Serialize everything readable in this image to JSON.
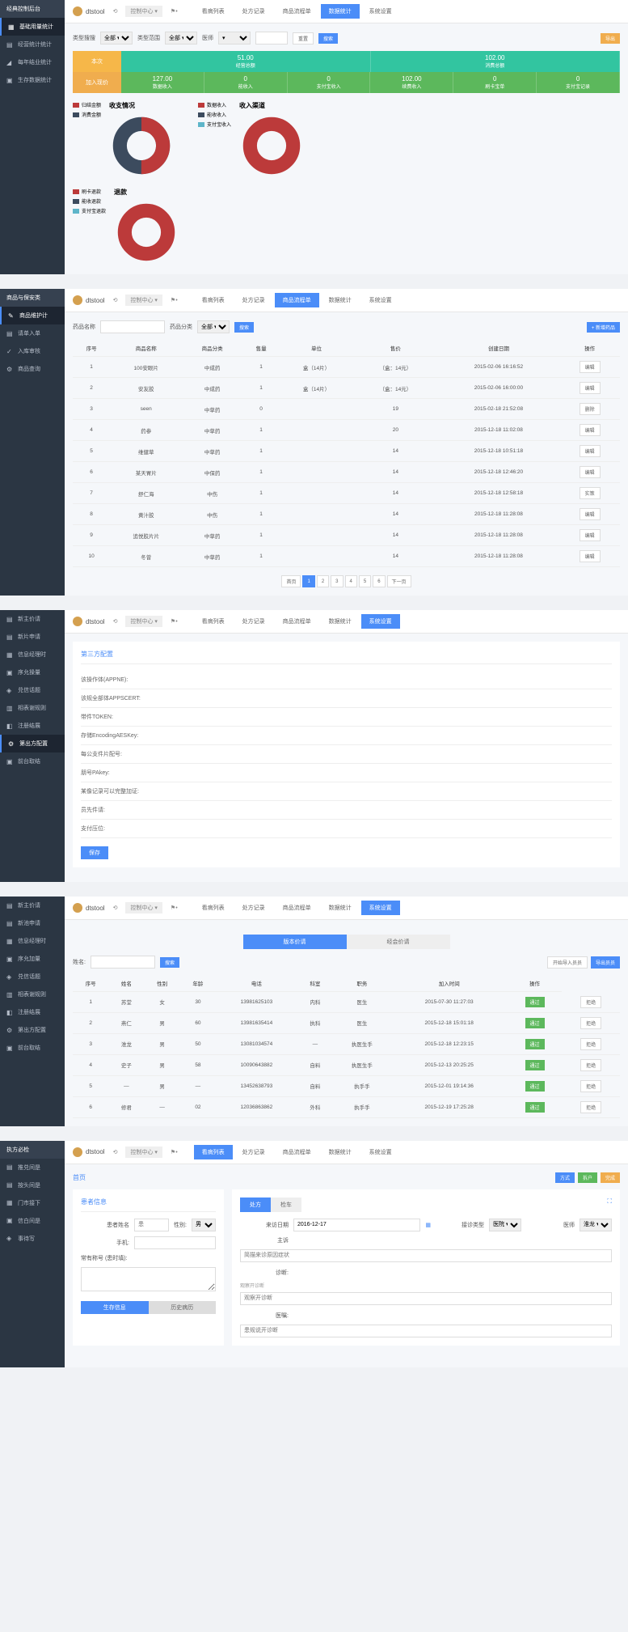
{
  "brand": "dtstool",
  "top_dd": "控制中心 ▾",
  "tabs": [
    "看病列表",
    "处方记录",
    "商品流程单",
    "数据统计",
    "系统设置"
  ],
  "s1": {
    "sidebar_hdr": "经典控制后台",
    "sidebar": [
      {
        "icon": "▦",
        "label": "基础用量统计"
      },
      {
        "icon": "▤",
        "label": "经营统计统计"
      },
      {
        "icon": "◢",
        "label": "每年结业统计"
      },
      {
        "icon": "▣",
        "label": "生存数据统计"
      }
    ],
    "filters": {
      "l1": "类型搜搜",
      "l2": "类型范围",
      "l3": "医师",
      "opt1": "全部 ▾",
      "opt2": "全部 ▾",
      "opt3": "▾",
      "reset": "重置",
      "search": "搜索",
      "export": "导出"
    },
    "left_cards": {
      "top": "本次",
      "bot": "加入现价"
    },
    "sumtop": [
      {
        "v": "51.00",
        "l": "经营总额"
      },
      {
        "v": "102.00",
        "l": "消费总额"
      }
    ],
    "sumbot": [
      {
        "v": "127.00",
        "l": "数据收入"
      },
      {
        "v": "0",
        "l": "能收入"
      },
      {
        "v": "0",
        "l": "支付宝收入"
      },
      {
        "v": "102.00",
        "l": "续费收入"
      },
      {
        "v": "0",
        "l": "刷卡宝单"
      },
      {
        "v": "0",
        "l": "支付宝记录"
      }
    ],
    "chart1": {
      "title": "收支情况",
      "legend": [
        {
          "c": "#bc3a3a",
          "t": "归结金额"
        },
        {
          "c": "#3c4b5e",
          "t": "消费金额"
        }
      ]
    },
    "chart2": {
      "title": "收入渠道",
      "legend": [
        {
          "c": "#bc3a3a",
          "t": "数据收入"
        },
        {
          "c": "#3c4b5e",
          "t": "能收收入"
        },
        {
          "c": "#5eb5c9",
          "t": "支付宝收入"
        }
      ]
    },
    "chart3": {
      "title": "退款",
      "legend": [
        {
          "c": "#bc3a3a",
          "t": "刷卡退款"
        },
        {
          "c": "#3c4b5e",
          "t": "能收退款"
        },
        {
          "c": "#5eb5c9",
          "t": "支付宝退款"
        }
      ]
    }
  },
  "s2": {
    "sidebar_hdr": "商品与保安类",
    "sidebar": [
      {
        "icon": "✎",
        "label": "商品维护计"
      },
      {
        "icon": "▤",
        "label": "请单入单"
      },
      {
        "icon": "✓",
        "label": "入库审核"
      },
      {
        "icon": "⚙",
        "label": "商品查询"
      }
    ],
    "active_tab": 2,
    "filter": {
      "l1": "药品名称",
      "l2": "药品分类",
      "opt": "全部 ▾",
      "search": "搜索",
      "add": "+ 新增药品"
    },
    "cols": [
      "序号",
      "商品名称",
      "商品分类",
      "售量",
      "单位",
      "售价",
      "创建日期",
      "操作"
    ],
    "rows": [
      [
        "1",
        "100安眼片",
        "中成药",
        "1",
        "盒（14片）",
        "（盒：14元）",
        "2015-02-06 16:16:52",
        "编辑"
      ],
      [
        "2",
        "安友胶",
        "中成药",
        "1",
        "盒（14片）",
        "（盒：14元）",
        "2015-02-06 16:00:00",
        "编辑"
      ],
      [
        "3",
        "seen",
        "中草药",
        "0",
        "",
        "19",
        "2015-02-18 21:52:08",
        "删除"
      ],
      [
        "4",
        "药参",
        "中草药",
        "1",
        "",
        "20",
        "2015-12-18 11:02:08",
        "编辑"
      ],
      [
        "5",
        "维健草",
        "中草药",
        "1",
        "",
        "14",
        "2015-12-18 10:51:18",
        "编辑"
      ],
      [
        "6",
        "某天胃片",
        "中保药",
        "1",
        "",
        "14",
        "2015-12-18 12:46:20",
        "编辑"
      ],
      [
        "7",
        "舒仁海",
        "中伤",
        "1",
        "",
        "14",
        "2015-12-18 12:58:18",
        "实策"
      ],
      [
        "8",
        "黄汁胶",
        "中伤",
        "1",
        "",
        "14",
        "2015-12-18 11:28:08",
        "编辑"
      ],
      [
        "9",
        "追悦胶片片",
        "中草药",
        "1",
        "",
        "14",
        "2015-12-18 11:28:08",
        "编辑"
      ],
      [
        "10",
        "冬曾",
        "中草药",
        "1",
        "",
        "14",
        "2015-12-18 11:28:08",
        "编辑"
      ]
    ],
    "pages": [
      "首页",
      "1",
      "2",
      "3",
      "4",
      "5",
      "6",
      "下一页"
    ]
  },
  "s3": {
    "active_tab": 4,
    "sidebar": [
      {
        "icon": "▤",
        "label": "新主价请"
      },
      {
        "icon": "▤",
        "label": "新片申请"
      },
      {
        "icon": "▦",
        "label": "信息经理时"
      },
      {
        "icon": "▣",
        "label": "序允操量"
      },
      {
        "icon": "◈",
        "label": "兑信话题"
      },
      {
        "icon": "▥",
        "label": "相表谢规则"
      },
      {
        "icon": "◧",
        "label": "注册结展"
      },
      {
        "icon": "⚙",
        "label": "第出方配置"
      },
      {
        "icon": "▣",
        "label": "前台取结"
      }
    ],
    "active_side": 7,
    "panel_title": "第三方配置",
    "fields": [
      "该操作体(APPNE):",
      "该规全部体APPSCERT:",
      "带件TOKEN:",
      "存储EncodingAESKey:",
      "每公支件片配号:",
      "朋号PAkey:",
      "某像记录可以完整加证:",
      "员先件请:",
      "支付压位:"
    ],
    "save": "保存"
  },
  "s4": {
    "active_tab": 4,
    "sidebar": [
      {
        "icon": "▤",
        "label": "新主价请"
      },
      {
        "icon": "▤",
        "label": "新池申请"
      },
      {
        "icon": "▦",
        "label": "信息经理时"
      },
      {
        "icon": "▣",
        "label": "序允加量"
      },
      {
        "icon": "◈",
        "label": "兑信话题"
      },
      {
        "icon": "▥",
        "label": "相表谢规则"
      },
      {
        "icon": "◧",
        "label": "注册结展"
      },
      {
        "icon": "⚙",
        "label": "第出方配置"
      },
      {
        "icon": "▣",
        "label": "前台取结"
      }
    ],
    "tab_sw": [
      "版本价请",
      "经会价请"
    ],
    "search_l": "姓名:",
    "search_btn": "搜索",
    "import": "开始导入员员",
    "export": "导出员员",
    "cols": [
      "序号",
      "姓名",
      "性别",
      "年龄",
      "电话",
      "科室",
      "职务",
      "加入时间",
      "操作"
    ],
    "rows": [
      [
        "1",
        "苏堂",
        "女",
        "30",
        "13981625103",
        "内科",
        "医生",
        "2015-07-30 11:27:03",
        "通过",
        "拒绝"
      ],
      [
        "2",
        "燕仁",
        "男",
        "60",
        "13981635414",
        "执科",
        "医生",
        "2015-12-18 15:01:18",
        "通过",
        "拒绝"
      ],
      [
        "3",
        "淮龙",
        "男",
        "50",
        "13081034574",
        "—",
        "执医生手",
        "2015-12-18 12:23:15",
        "通过",
        "拒绝"
      ],
      [
        "4",
        "史子",
        "男",
        "58",
        "10090643882",
        "自料",
        "执医生手",
        "2015-12-13 20:25:25",
        "通过",
        "拒绝"
      ],
      [
        "5",
        "—",
        "男",
        "—",
        "13452638793",
        "自料",
        "执手手",
        "2015-12-01 19:14:36",
        "通过",
        "拒绝"
      ],
      [
        "6",
        "修君",
        "—",
        "02",
        "12036863862",
        "外科",
        "执手手",
        "2015-12-19 17:25:28",
        "通过",
        "拒绝"
      ]
    ]
  },
  "s5": {
    "active_tab": 0,
    "sidebar_hdr": "执方必检",
    "sidebar": [
      {
        "icon": "▤",
        "label": "推兑间是"
      },
      {
        "icon": "▤",
        "label": "按头间是"
      },
      {
        "icon": "▦",
        "label": "门市接下"
      },
      {
        "icon": "▣",
        "label": "信白间是"
      },
      {
        "icon": "◈",
        "label": "事待写"
      }
    ],
    "breadcrumb": "首页",
    "add": "方式",
    "edit": "拆户",
    "complete": "完成",
    "left_title": "患者信息",
    "right_tabs": [
      "处方",
      "检车"
    ],
    "left_fields": {
      "name": "患者姓名",
      "name_ph": "患",
      "gender": "性别:",
      "gender_opt": "男 ▾",
      "phone": "手机:",
      "note": "常有称号 (患时填):"
    },
    "right_fields": {
      "date_l": "来访日期",
      "date_v": "2016-12-17",
      "dept_l": "接诊类型",
      "dept_v": "医院 ▾",
      "doc_l": "医师",
      "doc_v": "淮龙 ▾",
      "symptom": "主诉",
      "symptom_ph": "简描来诊原因症状",
      "diag": "诊断:",
      "diag_sub": "观察开诊断",
      "diag_ph": "观察开诊断",
      "advice": "医嘱:",
      "advice_ph": "患规说开诊断"
    }
  },
  "chart_data": [
    {
      "type": "pie",
      "title": "收支情况",
      "series": [
        {
          "name": "归结金额",
          "value": 50,
          "color": "#bc3a3a"
        },
        {
          "name": "消费金额",
          "value": 50,
          "color": "#3c4b5e"
        }
      ]
    },
    {
      "type": "pie",
      "title": "收入渠道",
      "series": [
        {
          "name": "数据收入",
          "value": 100,
          "color": "#bc3a3a"
        },
        {
          "name": "能收收入",
          "value": 0,
          "color": "#3c4b5e"
        },
        {
          "name": "支付宝收入",
          "value": 0,
          "color": "#5eb5c9"
        }
      ]
    },
    {
      "type": "pie",
      "title": "退款",
      "series": [
        {
          "name": "刷卡退款",
          "value": 100,
          "color": "#bc3a3a"
        },
        {
          "name": "能收退款",
          "value": 0,
          "color": "#3c4b5e"
        },
        {
          "name": "支付宝退款",
          "value": 0,
          "color": "#5eb5c9"
        }
      ]
    }
  ]
}
